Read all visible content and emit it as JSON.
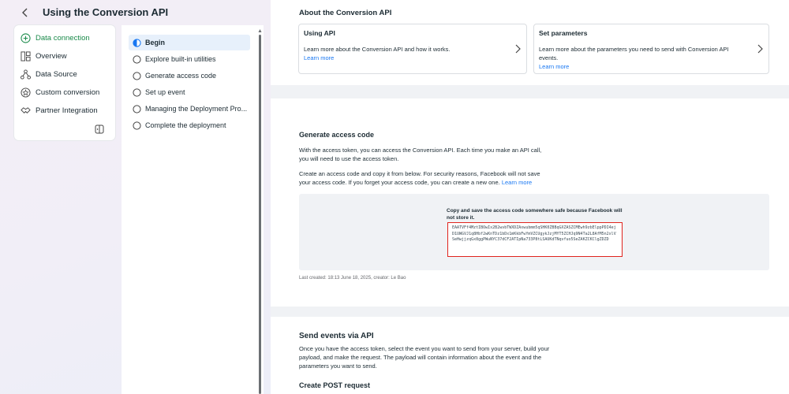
{
  "header": {
    "title": "Using the Conversion API"
  },
  "nav": {
    "items": [
      {
        "label": "Data connection",
        "icon": "plus-circle-icon",
        "active": true
      },
      {
        "label": "Overview",
        "icon": "dashboard-icon"
      },
      {
        "label": "Data Source",
        "icon": "data-source-icon"
      },
      {
        "label": "Custom conversion",
        "icon": "star-circle-icon"
      },
      {
        "label": "Partner Integration",
        "icon": "handshake-icon"
      }
    ]
  },
  "steps": {
    "items": [
      {
        "label": "Begin",
        "active": true
      },
      {
        "label": "Explore built-in utilities"
      },
      {
        "label": "Generate access code"
      },
      {
        "label": "Set up event"
      },
      {
        "label": "Managing the Deployment Pro..."
      },
      {
        "label": "Complete the deployment"
      }
    ]
  },
  "about": {
    "title": "About the Conversion API",
    "cards": [
      {
        "title": "Using API",
        "desc": "Learn more about the Conversion API and how it works.",
        "link": "Learn more"
      },
      {
        "title": "Set parameters",
        "desc": "Learn more about the parameters you need to send with Conversion API events.",
        "link": "Learn more"
      }
    ]
  },
  "generate": {
    "title": "Generate access code",
    "p1": "With the access token, you can access the Conversion API. Each time you make an API call, you will need to use the access token.",
    "p2": "Create an access code and copy it from below. For security reasons, Facebook will not save your access code. If you forget your access code, you can create a new one.",
    "p2_link": "Learn more",
    "note": "Copy and save the access code somewhere safe because Facebook will not store it.",
    "token": "EAATVFf4MztIBOwIx2B2wvbTWXDZAxwubmm5qSHK0ZBBqGXZASZCMEwh9zbElppPDI4ejD1UWGVJ1q8Hbf2wKnTDz1bDx1mKkbFwYmVZCUgykJzjMYT5ZCHJq9N4Ta2L8AfM5n2xlVSeHwjjzqGx8ggPWuNYC37dCF2ATIpNa733P8tLSAUKdTNqvfuo5SeZAKZCKClgZDZD",
    "last_created": "Last created: 18:13 June 18, 2025, creator: Le Bao"
  },
  "send": {
    "title": "Send events via API",
    "p": "Once you have the access token, select the event you want to send from your server, build your payload, and make the request. The payload will contain information about the event and the parameters you want to send.",
    "post_title": "Create POST request"
  },
  "colors": {
    "accent": "#1877f2",
    "active_green": "#1a8a4a",
    "highlight_red": "#e0241e",
    "active_step_bg": "#e7f0fb"
  }
}
